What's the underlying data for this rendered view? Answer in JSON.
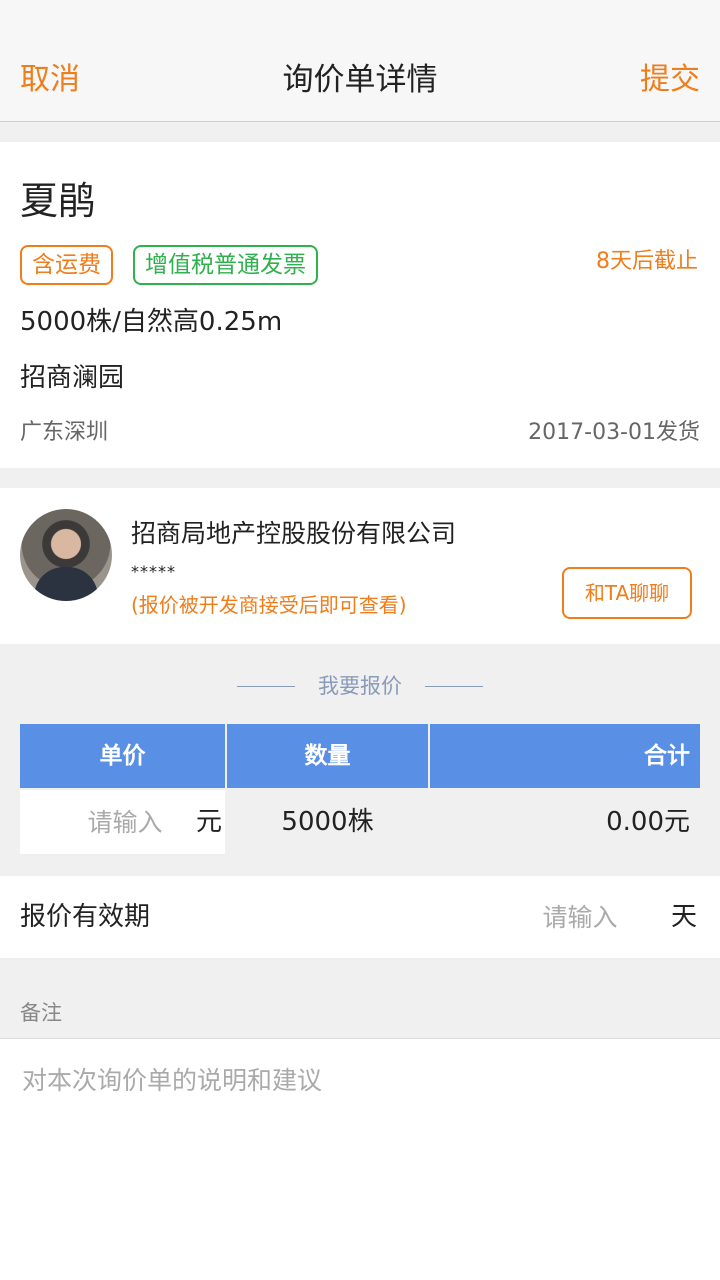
{
  "nav": {
    "cancel": "取消",
    "title": "询价单详情",
    "submit": "提交"
  },
  "inquiry": {
    "buyer_name": "夏鹃",
    "tags": {
      "freight": "含运费",
      "invoice": "增值税普通发票"
    },
    "deadline": "8天后截止",
    "spec": "5000株/自然高0.25m",
    "project": "招商澜园",
    "location": "广东深圳",
    "ship_date": "2017-03-01发货"
  },
  "developer": {
    "company": "招商局地产控股股份有限公司",
    "masked_contact": "*****",
    "note": "(报价被开发商接受后即可查看)",
    "chat_label": "和TA聊聊"
  },
  "quote": {
    "section_title": "我要报价",
    "headers": {
      "unit_price": "单价",
      "quantity": "数量",
      "total": "合计"
    },
    "price_placeholder": "请输入",
    "price_unit": "元",
    "quantity_value": "5000株",
    "total_value": "0.00元"
  },
  "validity": {
    "label": "报价有效期",
    "placeholder": "请输入",
    "unit": "天"
  },
  "remark": {
    "label": "备注",
    "placeholder": "对本次询价单的说明和建议"
  },
  "colors": {
    "accent": "#ef7d1b",
    "invoice_tag": "#2fb24e",
    "table_header": "#5a8fe6"
  }
}
